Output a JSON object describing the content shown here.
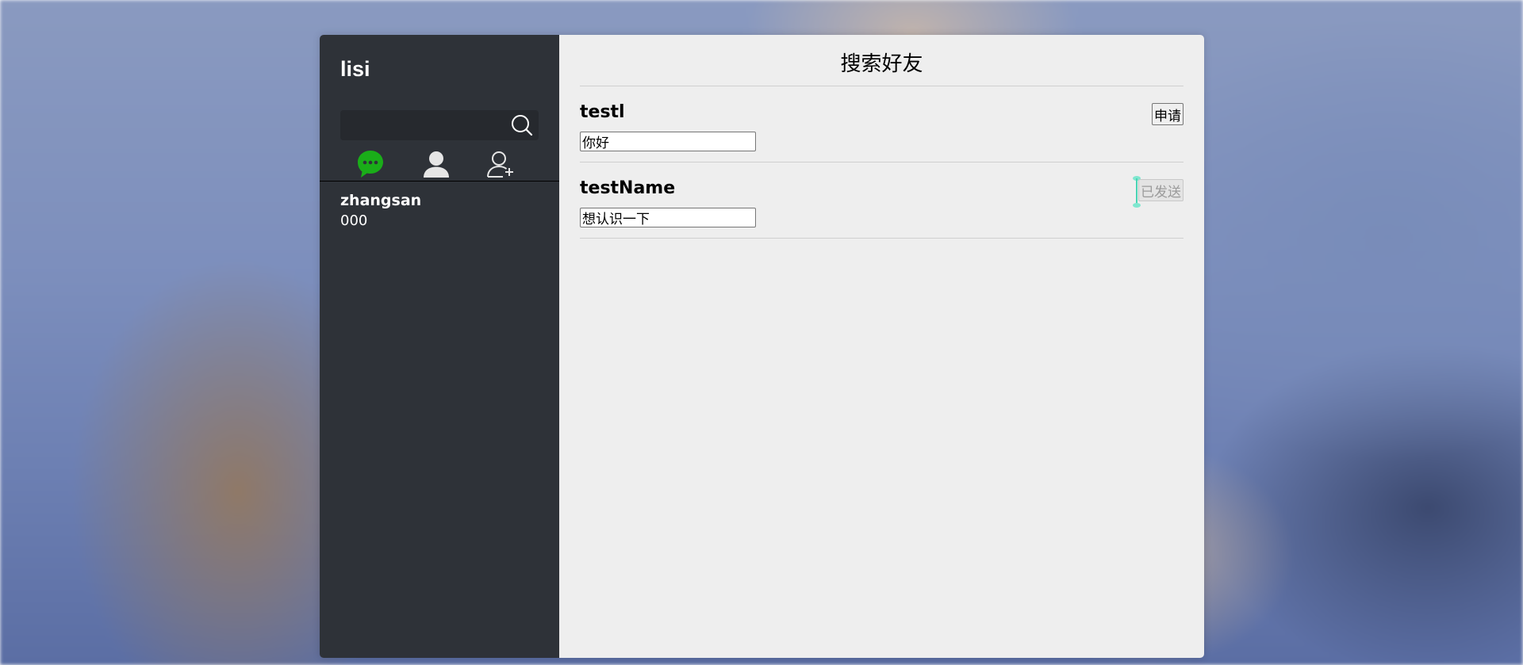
{
  "sidebar": {
    "user_name": "lisi",
    "search": {
      "value": "",
      "placeholder": ""
    },
    "nav": {
      "chat_icon": "chat-bubble-icon",
      "contacts_icon": "person-icon",
      "add_friend_icon": "add-person-icon",
      "active_color": "#1aad19"
    },
    "contacts": [
      {
        "name": "zhangsan",
        "last_message": "000"
      }
    ]
  },
  "main": {
    "title": "搜索好友",
    "results": [
      {
        "name": "testl",
        "message": "你好",
        "button_label": "申请",
        "button_state": "enabled"
      },
      {
        "name": "testName",
        "message": "想认识一下",
        "button_label": "已发送",
        "button_state": "disabled"
      }
    ]
  },
  "colors": {
    "sidebar_bg": "#2e3238",
    "main_bg": "#eeeeee",
    "accent": "#1aad19"
  }
}
